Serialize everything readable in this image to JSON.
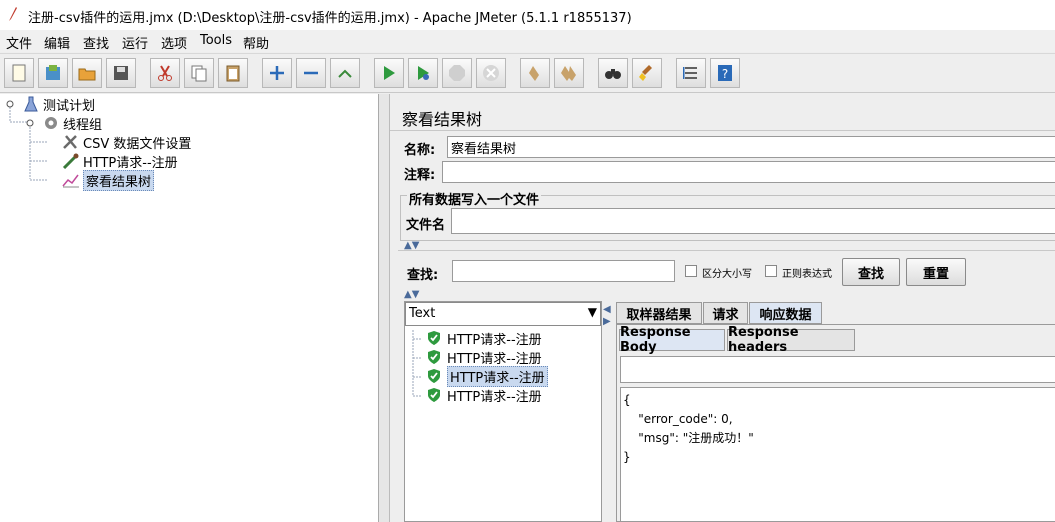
{
  "window": {
    "title": "注册-csv插件的运用.jmx (D:\\Desktop\\注册-csv插件的运用.jmx) - Apache JMeter (5.1.1 r1855137)"
  },
  "menu": [
    "文件",
    "编辑",
    "查找",
    "运行",
    "选项",
    "Tools",
    "帮助"
  ],
  "toolbar": [
    "new-icon",
    "templates-icon",
    "open-icon",
    "save-icon",
    "cut-icon",
    "copy-icon",
    "paste-icon",
    "expand-icon",
    "collapse-icon",
    "toggle-icon",
    "start-icon",
    "start-no-pause-icon",
    "stop-icon",
    "shutdown-icon",
    "clear-icon",
    "clear-all-icon",
    "search-icon",
    "reset-search-icon",
    "function-helper-icon",
    "help-icon"
  ],
  "tree": {
    "items": [
      {
        "label": "测试计划",
        "icon": "flask-icon"
      },
      {
        "label": "线程组",
        "icon": "gear-icon"
      },
      {
        "label": "CSV 数据文件设置",
        "icon": "tools-icon"
      },
      {
        "label": "HTTP请求--注册",
        "icon": "pipette-icon"
      },
      {
        "label": "察看结果树",
        "icon": "graph-icon"
      }
    ],
    "selected": 4
  },
  "panel": {
    "title": "察看结果树",
    "name_label": "名称:",
    "name_value": "察看结果树",
    "comment_label": "注释:",
    "comment_value": "",
    "file_group_title": "所有数据写入一个文件",
    "filename_label": "文件名",
    "filename_value": ""
  },
  "search": {
    "label": "查找:",
    "value": "",
    "case_label": "区分大小写",
    "regex_label": "正则表达式",
    "find_button": "查找",
    "reset_button": "重置"
  },
  "results": {
    "renderer": "Text",
    "items": [
      "HTTP请求--注册",
      "HTTP请求--注册",
      "HTTP请求--注册",
      "HTTP请求--注册"
    ],
    "selected": 2,
    "tabs": [
      "取样器结果",
      "请求",
      "响应数据"
    ],
    "active_tab": 2,
    "subtabs": [
      "Response Body",
      "Response headers"
    ],
    "active_subtab": 0,
    "body_lines": [
      "{",
      "    \"error_code\": 0,",
      "    \"msg\": \"注册成功！\"",
      "}"
    ]
  },
  "colors": {
    "success": "#2e9a3e",
    "selection": "#c9d9ef"
  }
}
